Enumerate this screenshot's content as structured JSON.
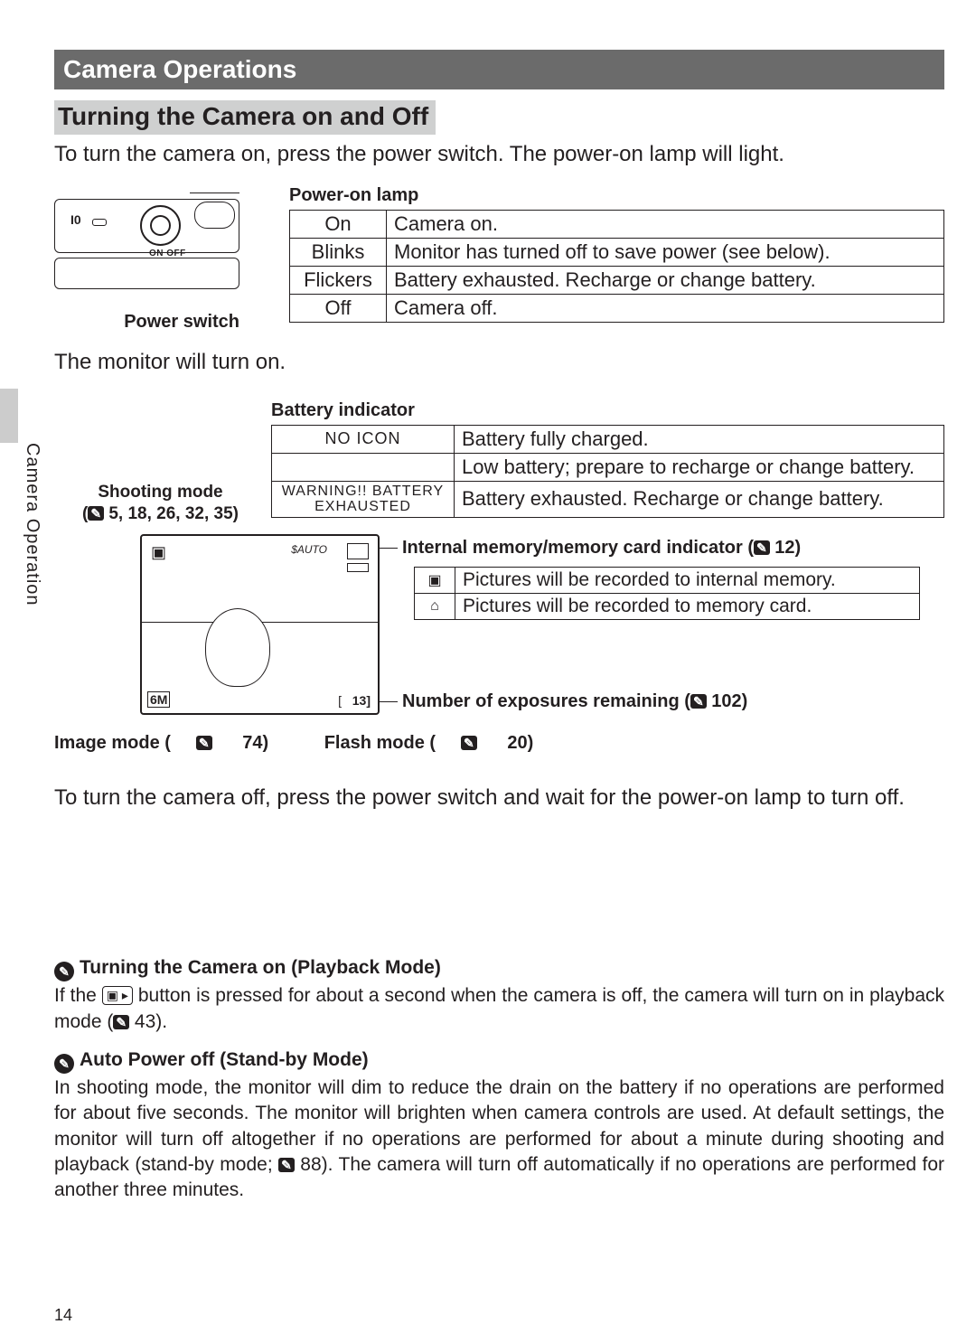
{
  "header": "Camera Operations",
  "section_title": "Turning the Camera on and Off",
  "side_tab": "Camera Operation",
  "intro": "To turn the camera on, press the power switch.  The power-on lamp will light.",
  "power": {
    "lamp_title": "Power-on lamp",
    "switch_label": "Power switch",
    "diagram_onoff": "ON  OFF",
    "diagram_io": "I0",
    "rows": [
      {
        "state": "On",
        "desc": "Camera on."
      },
      {
        "state": "Blinks",
        "desc": "Monitor has turned off to save power (see below)."
      },
      {
        "state": "Flickers",
        "desc": "Battery exhausted.  Recharge or change battery."
      },
      {
        "state": "Off",
        "desc": "Camera off."
      }
    ]
  },
  "monitor_on": "The monitor will turn on.",
  "battery": {
    "title": "Battery indicator",
    "rows": [
      {
        "state": "NO ICON",
        "desc": "Battery fully charged."
      },
      {
        "state": "",
        "desc": "Low battery; prepare to recharge or change battery."
      },
      {
        "state": "WARNING!! BATTERY EXHAUSTED",
        "desc": "Battery exhausted.  Recharge or change battery."
      }
    ],
    "shooting_mode_l1": "Shooting mode",
    "shooting_mode_l2_pre": "(",
    "shooting_mode_l2_nums": " 5, 18, 26, 32, 35)"
  },
  "lcd": {
    "mem_title_pre": "Internal memory/memory card indicator (",
    "mem_title_num": " 12)",
    "mem_rows": [
      {
        "icon": "▣",
        "desc": "Pictures will be recorded to internal memory."
      },
      {
        "icon": "⌂",
        "desc": "Pictures will be recorded to memory card."
      }
    ],
    "exp_pre": "Number of exposures remaining (",
    "exp_num": " 102)",
    "image_mode_pre": "Image mode (",
    "image_mode_num": " 74)",
    "flash_mode_pre": "Flash mode (",
    "flash_mode_num": " 20)",
    "bl_text": "6M",
    "br1_text": "[",
    "br2_text": "13]",
    "flash_text": "$AUTO"
  },
  "turn_off": "To turn the camera off, press the power switch and wait for the power-on lamp to turn off.",
  "note1": {
    "title": "Turning the Camera on (Playback Mode)",
    "t1": "If the ",
    "btn": "▣ ▸",
    "t2": " button is pressed for about a second when the camera is off, the camera will turn on in playback mode (",
    "ref": " 43)."
  },
  "note2": {
    "title": "Auto Power off (Stand-by Mode)",
    "t1": "In shooting mode,  the monitor will dim to reduce the drain on the battery if no operations are performed for about five seconds.  The monitor will brighten when camera controls are used.  At default settings, the monitor will turn off altogether if no operations are performed for about a minute during shooting and playback (stand-by mode; ",
    "ref": " 88",
    "t2": ").  The camera will turn off automatically if no operations are performed for another three minutes."
  },
  "page_number": "14",
  "ref_icon_glyph": "✎"
}
